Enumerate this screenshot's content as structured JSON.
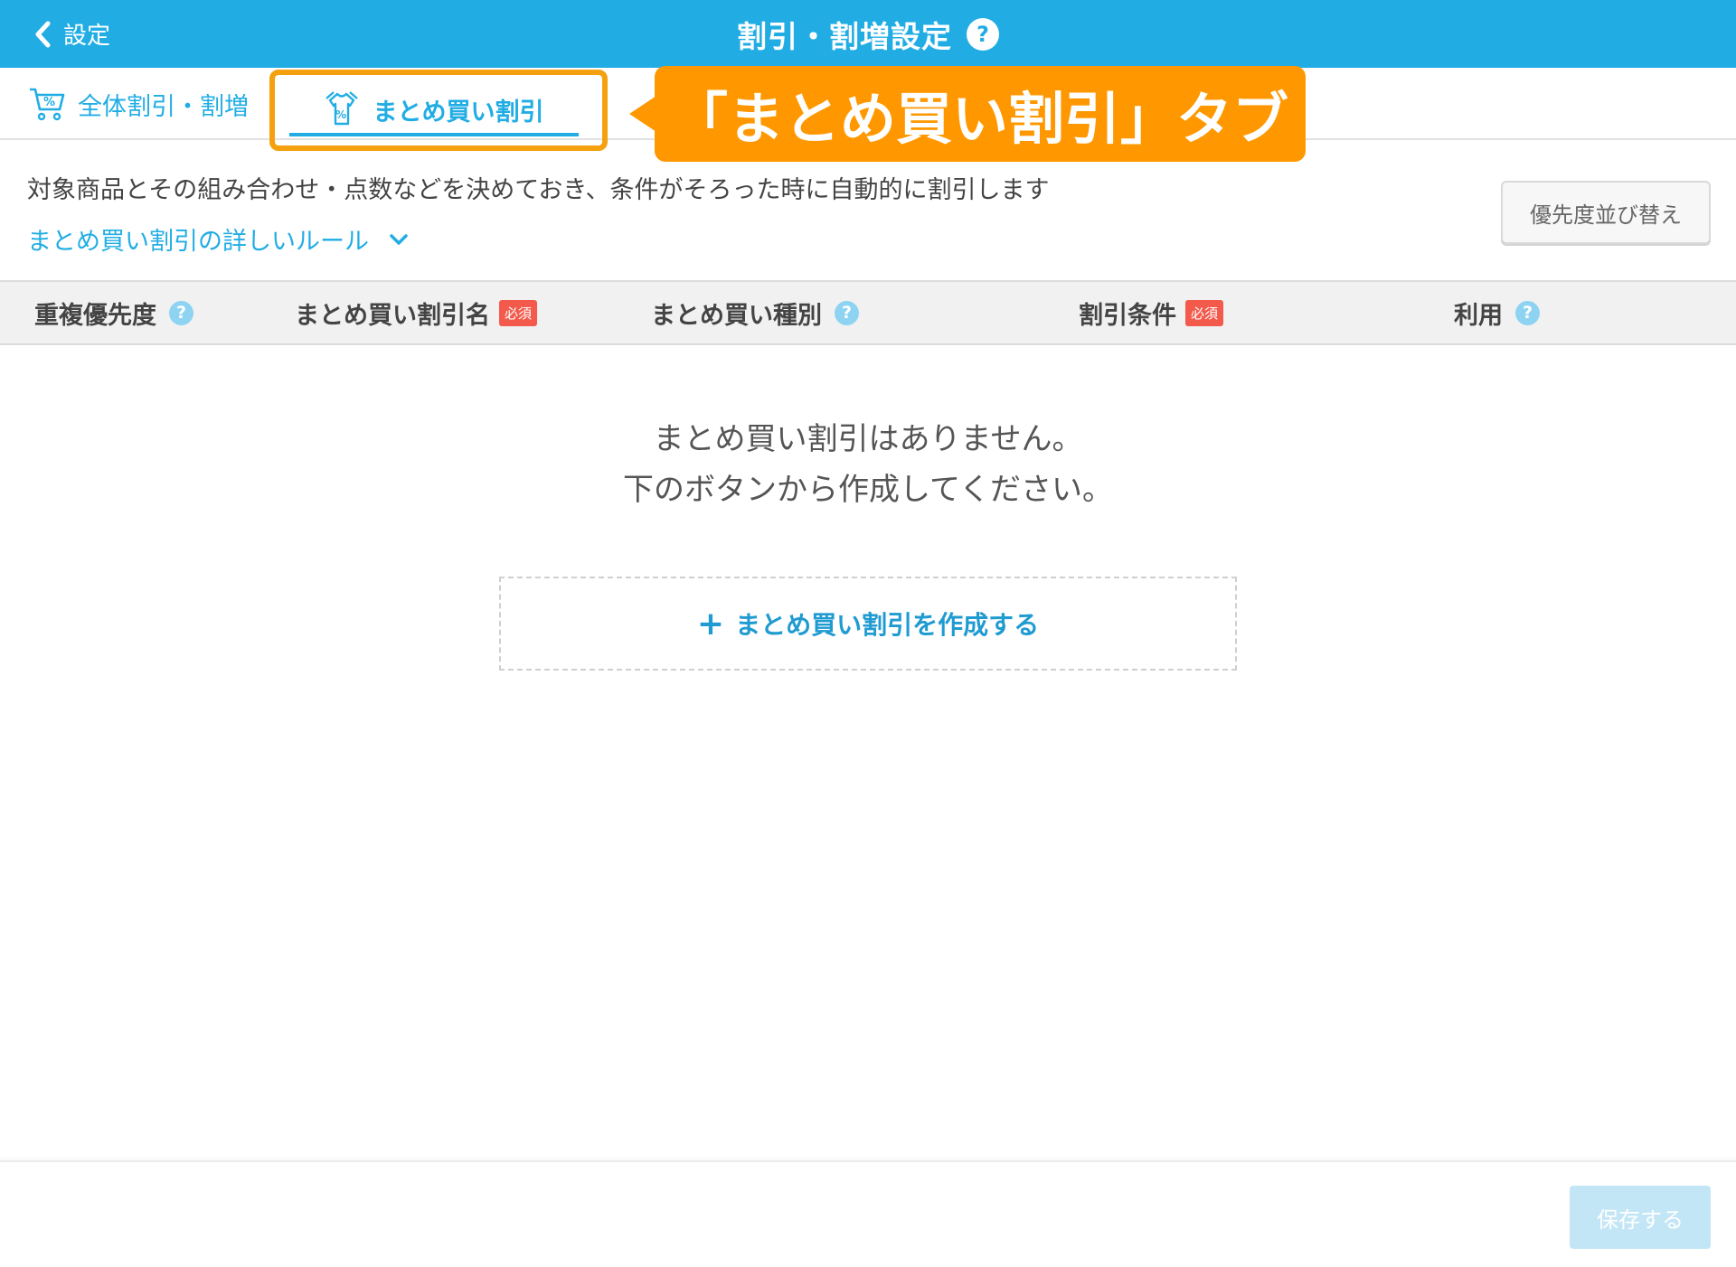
{
  "header": {
    "back_label": "設定",
    "title": "割引・割増設定",
    "help_mark": "?"
  },
  "tabs": [
    {
      "label": "全体割引・割増",
      "icon": "cart-percent-icon"
    },
    {
      "label": "まとめ買い割引",
      "icon": "shirts-percent-icon",
      "active": true
    }
  ],
  "callout": {
    "text": "「まとめ買い割引」タブ"
  },
  "description": {
    "text": "対象商品とその組み合わせ・点数などを決めておき、条件がそろった時に自動的に割引します",
    "rules_link": "まとめ買い割引の詳しいルール"
  },
  "priority_button": "優先度並び替え",
  "table": {
    "required_badge": "必須",
    "columns": [
      {
        "label": "重複優先度",
        "help": true
      },
      {
        "label": "まとめ買い割引名",
        "required": true
      },
      {
        "label": "まとめ買い種別",
        "help": true
      },
      {
        "label": "割引条件",
        "required": true
      },
      {
        "label": "利用",
        "help": true
      }
    ]
  },
  "empty_state": {
    "line1": "まとめ買い割引はありません。",
    "line2": "下のボタンから作成してください。"
  },
  "create_button": {
    "plus": "+",
    "label": "まとめ買い割引を作成する"
  },
  "footer": {
    "save_label": "保存する"
  },
  "colors": {
    "header": "#21ade4",
    "accent": "#21ade4",
    "callout": "#ff9800",
    "highlight_border": "#f4a00f",
    "required": "#f35a4c",
    "save_disabled": "#c3e6f6"
  }
}
